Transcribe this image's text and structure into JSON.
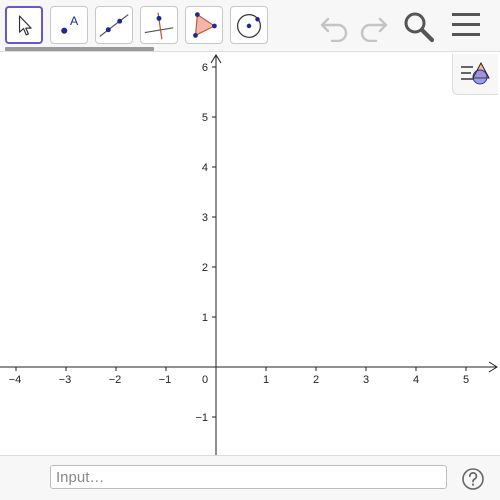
{
  "toolbar": {
    "tools": [
      {
        "name": "move-tool"
      },
      {
        "name": "point-tool",
        "label": "A"
      },
      {
        "name": "line-tool"
      },
      {
        "name": "perpendicular-line-tool"
      },
      {
        "name": "polygon-tool"
      },
      {
        "name": "circle-tool"
      }
    ],
    "actions": [
      "undo-icon",
      "redo-icon",
      "search-icon",
      "menu-icon"
    ],
    "colors": {
      "selected_border": "#6557d2",
      "polygon_fill": "#f4b6ab",
      "point": "#1a2a9a",
      "disabled_icon": "#c4c4c4",
      "active_icon": "#555555"
    },
    "loading_progress": 0.3
  },
  "graphics": {
    "x_ticks": [
      "−4",
      "−3",
      "−2",
      "−1",
      "0",
      "1",
      "2",
      "3",
      "4",
      "5"
    ],
    "y_ticks": [
      "6",
      "5",
      "4",
      "3",
      "2",
      "1",
      "−1"
    ],
    "x_range": [
      -4.3,
      5.7
    ],
    "y_range": [
      -1.75,
      6.3
    ],
    "grid": false
  },
  "style_panel": {
    "icon": "style-bar-icon"
  },
  "input_bar": {
    "placeholder": "Input…",
    "help_icon": "help-icon"
  }
}
